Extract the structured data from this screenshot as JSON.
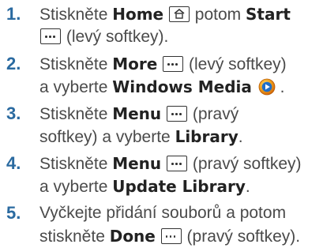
{
  "steps": [
    {
      "number": "1.",
      "line1": {
        "t1": "Stiskněte ",
        "b1": "Home",
        "t2": " potom ",
        "b2": "Start"
      },
      "line2": {
        "t1": " (levý softkey)."
      }
    },
    {
      "number": "2.",
      "line1": {
        "t1": "Stiskněte ",
        "b1": "More",
        "t2": " (levý softkey)"
      },
      "line2": {
        "t1": "a vyberte ",
        "b1": "Windows Media",
        "t2": " ."
      }
    },
    {
      "number": "3.",
      "line1": {
        "t1": "Stiskněte ",
        "b1": "Menu",
        "t2": " (pravý"
      },
      "line2": {
        "t1": "softkey) a vyberte ",
        "b1": "Library",
        "t2": "."
      }
    },
    {
      "number": "4.",
      "line1": {
        "t1": "Stiskněte ",
        "b1": "Menu",
        "t2": " (pravý softkey)"
      },
      "line2": {
        "t1": "a vyberte ",
        "b1": "Update Library",
        "t2": "."
      }
    },
    {
      "number": "5.",
      "line1": {
        "t1": "Vyčkejte přidání souborů a potom"
      },
      "line2": {
        "t1": "stiskněte ",
        "b1": "Done",
        "t2": " (pravý softkey)."
      }
    }
  ],
  "colors": {
    "number": "#2a6aa0",
    "text": "#4a4a4a",
    "bold": "#222222",
    "key_border": "#333333"
  },
  "icons": [
    "home-key-icon",
    "softkey-dots-icon",
    "windows-media-icon"
  ]
}
